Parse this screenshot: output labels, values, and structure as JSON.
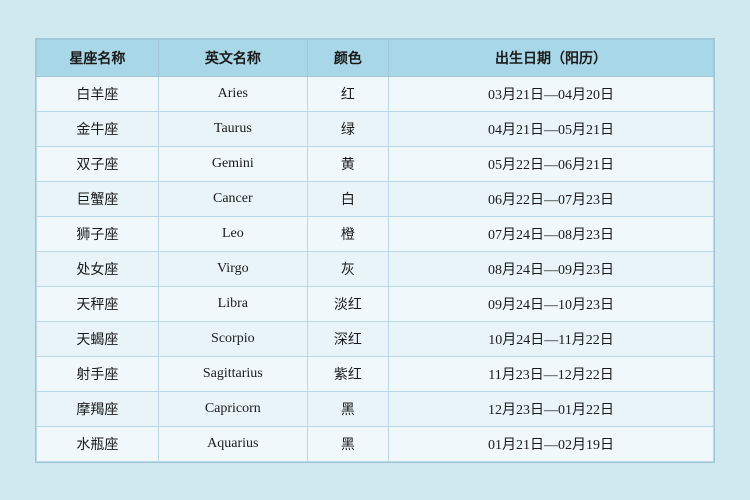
{
  "table": {
    "headers": {
      "chinese_name": "星座名称",
      "english_name": "英文名称",
      "color": "颜色",
      "birth_date": "出生日期（阳历）"
    },
    "rows": [
      {
        "chinese": "白羊座",
        "english": "Aries",
        "color": "红",
        "date": "03月21日—04月20日"
      },
      {
        "chinese": "金牛座",
        "english": "Taurus",
        "color": "绿",
        "date": "04月21日—05月21日"
      },
      {
        "chinese": "双子座",
        "english": "Gemini",
        "color": "黄",
        "date": "05月22日—06月21日"
      },
      {
        "chinese": "巨蟹座",
        "english": "Cancer",
        "color": "白",
        "date": "06月22日—07月23日"
      },
      {
        "chinese": "狮子座",
        "english": "Leo",
        "color": "橙",
        "date": "07月24日—08月23日"
      },
      {
        "chinese": "处女座",
        "english": "Virgo",
        "color": "灰",
        "date": "08月24日—09月23日"
      },
      {
        "chinese": "天秤座",
        "english": "Libra",
        "color": "淡红",
        "date": "09月24日—10月23日"
      },
      {
        "chinese": "天蝎座",
        "english": "Scorpio",
        "color": "深红",
        "date": "10月24日—11月22日"
      },
      {
        "chinese": "射手座",
        "english": "Sagittarius",
        "color": "紫红",
        "date": "11月23日—12月22日"
      },
      {
        "chinese": "摩羯座",
        "english": "Capricorn",
        "color": "黑",
        "date": "12月23日—01月22日"
      },
      {
        "chinese": "水瓶座",
        "english": "Aquarius",
        "color": "黑",
        "date": "01月21日—02月19日"
      }
    ]
  }
}
